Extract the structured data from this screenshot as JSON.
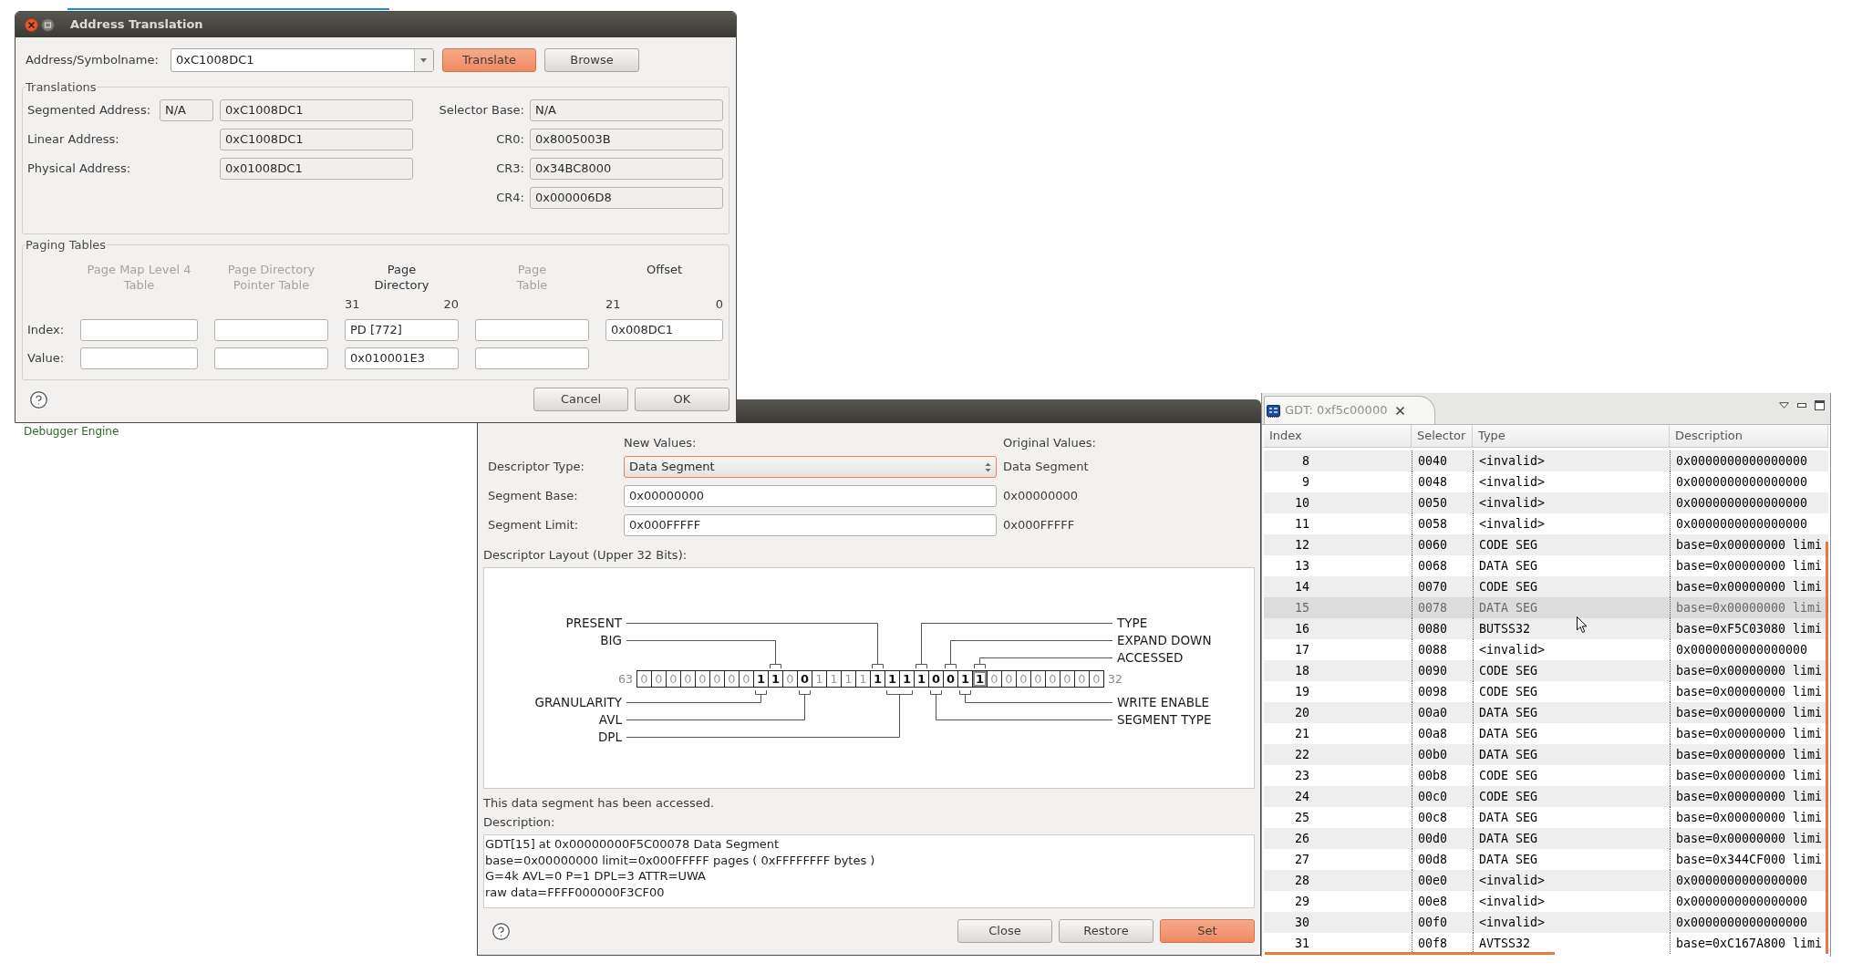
{
  "desktop": {
    "background_text": "Debugger Engine"
  },
  "address_translation": {
    "title": "Address Translation",
    "address": {
      "label": "Address/Symbolname:",
      "value": "0xC1008DC1"
    },
    "actions": [
      {
        "label": "Translate",
        "default": true
      },
      {
        "label": "Browse",
        "default": false
      }
    ],
    "translations": {
      "title": "Translations",
      "left": [
        {
          "label": "Segmented Address:",
          "selector": "N/A",
          "value": "0xC1008DC1"
        },
        {
          "label": "Linear Address:",
          "value": "0xC1008DC1"
        },
        {
          "label": "Physical Address:",
          "value": "0x01008DC1"
        }
      ],
      "right": [
        {
          "label": "Selector Base:",
          "value": "N/A"
        },
        {
          "label": "CR0:",
          "value": "0x8005003B"
        },
        {
          "label": "CR3:",
          "value": "0x34BC8000"
        },
        {
          "label": "CR4:",
          "value": "0x000006D8"
        }
      ]
    },
    "paging": {
      "title": "Paging Tables",
      "columns": [
        {
          "header": [
            "Page Map Level 4",
            "Table"
          ],
          "disabled": true
        },
        {
          "header": [
            "Page Directory",
            "Pointer Table"
          ],
          "disabled": true
        },
        {
          "header": [
            "Page",
            "Directory"
          ],
          "disabled": false,
          "bits": {
            "high": "31",
            "low": "20"
          }
        },
        {
          "header": [
            "Page",
            "Table"
          ],
          "disabled": true
        },
        {
          "header": [
            "Offset"
          ],
          "disabled": false,
          "bits": {
            "high": "21",
            "low": "0"
          }
        }
      ],
      "rows": [
        {
          "label": "Index:",
          "fields": [
            {
              "read_only": false
            },
            {
              "read_only": false
            },
            {
              "text": "PD [772]",
              "read_only": false
            },
            {
              "read_only": false
            },
            {
              "text": "0x008DC1",
              "read_only": false
            }
          ]
        },
        {
          "label": "Value:",
          "fields": [
            {
              "read_only": false
            },
            {
              "read_only": false
            },
            {
              "text": "0x010001E3",
              "read_only": false
            },
            {
              "read_only": false
            }
          ]
        }
      ]
    },
    "buttons": [
      {
        "label": "Cancel",
        "default": false
      },
      {
        "label": "OK",
        "default": false
      }
    ]
  },
  "descriptor_editor": {
    "new_values_heading": "New Values:",
    "original_values_heading": "Original Values:",
    "fields": [
      {
        "kind": "select",
        "label": "Descriptor Type:",
        "value": "Data Segment",
        "original": "Data Segment",
        "focused": true
      },
      {
        "kind": "text",
        "label": "Segment Base:",
        "value": "0x00000000",
        "original": "0x00000000",
        "focused": false
      },
      {
        "kind": "text",
        "label": "Segment Limit:",
        "value": "0x000FFFFF",
        "original": "0x000FFFFF",
        "focused": false
      }
    ],
    "layout": {
      "title": "Descriptor Layout (Upper 32 Bits):",
      "high_bit": "63",
      "low_bit": "32",
      "segments": [
        {
          "bits": [
            "0",
            "0",
            "0",
            "0",
            "0",
            "0",
            "0",
            "0"
          ],
          "emphasized": false,
          "highlighted": false
        },
        {
          "bits": [
            "1"
          ],
          "emphasized": true,
          "highlighted": false,
          "leader": {
            "text": "GRANULARITY",
            "on_left": true,
            "above": false
          }
        },
        {
          "bits": [
            "1"
          ],
          "emphasized": true,
          "highlighted": false,
          "leader": {
            "text": "BIG",
            "on_left": true,
            "above": true
          }
        },
        {
          "bits": [
            "0"
          ],
          "emphasized": false,
          "highlighted": false
        },
        {
          "bits": [
            "0"
          ],
          "emphasized": true,
          "highlighted": false,
          "leader": {
            "text": "AVL",
            "on_left": true,
            "above": false
          }
        },
        {
          "bits": [
            "1",
            "1",
            "1",
            "1"
          ],
          "emphasized": false,
          "highlighted": false
        },
        {
          "bits": [
            "1"
          ],
          "emphasized": true,
          "highlighted": false,
          "leader": {
            "text": "PRESENT",
            "on_left": true,
            "above": true
          }
        },
        {
          "bits": [
            "1",
            "1"
          ],
          "emphasized": true,
          "highlighted": false,
          "leader": {
            "text": "DPL",
            "on_left": true,
            "above": false
          }
        },
        {
          "bits": [
            "1"
          ],
          "emphasized": true,
          "highlighted": false,
          "leader": {
            "text": "TYPE",
            "on_left": false,
            "above": true
          }
        },
        {
          "bits": [
            "0"
          ],
          "emphasized": true,
          "highlighted": false,
          "leader": {
            "text": "SEGMENT TYPE",
            "on_left": false,
            "above": false
          }
        },
        {
          "bits": [
            "0"
          ],
          "emphasized": true,
          "highlighted": false,
          "leader": {
            "text": "EXPAND DOWN",
            "on_left": false,
            "above": true
          }
        },
        {
          "bits": [
            "1"
          ],
          "emphasized": true,
          "highlighted": false,
          "leader": {
            "text": "WRITE ENABLE",
            "on_left": false,
            "above": false
          }
        },
        {
          "bits": [
            "1"
          ],
          "emphasized": true,
          "highlighted": true,
          "leader": {
            "text": "ACCESSED",
            "on_left": false,
            "above": true
          }
        },
        {
          "bits": [
            "0",
            "0",
            "0",
            "0",
            "0",
            "0",
            "0",
            "0"
          ],
          "emphasized": false,
          "highlighted": false
        }
      ]
    },
    "status": "This data segment has been accessed.",
    "description_label": "Description:",
    "description_lines": [
      "GDT[15] at 0x00000000F5C00078 Data Segment",
      "base=0x00000000 limit=0x000FFFFF pages ( 0xFFFFFFFF bytes )",
      "G=4k AVL=0 P=1 DPL=3 ATTR=UWA",
      "raw data=FFFF000000F3CF00"
    ],
    "buttons": [
      {
        "label": "Close",
        "default": false
      },
      {
        "label": "Restore",
        "default": false
      },
      {
        "label": "Set",
        "default": true
      }
    ]
  },
  "gdt_view": {
    "tab": {
      "title": "GDT: 0xf5c00000",
      "active": false
    },
    "columns": [
      "Index",
      "Selector",
      "Type",
      "Description"
    ],
    "rows": [
      {
        "index": "8",
        "selector": "0040",
        "type": "<invalid>",
        "description": "0x0000000000000000",
        "selected": false
      },
      {
        "index": "9",
        "selector": "0048",
        "type": "<invalid>",
        "description": "0x0000000000000000",
        "selected": false
      },
      {
        "index": "10",
        "selector": "0050",
        "type": "<invalid>",
        "description": "0x0000000000000000",
        "selected": false
      },
      {
        "index": "11",
        "selector": "0058",
        "type": "<invalid>",
        "description": "0x0000000000000000",
        "selected": false
      },
      {
        "index": "12",
        "selector": "0060",
        "type": "CODE SEG",
        "description": "base=0x00000000 limi",
        "selected": false
      },
      {
        "index": "13",
        "selector": "0068",
        "type": "DATA SEG",
        "description": "base=0x00000000 limi",
        "selected": false
      },
      {
        "index": "14",
        "selector": "0070",
        "type": "CODE SEG",
        "description": "base=0x00000000 limi",
        "selected": false
      },
      {
        "index": "15",
        "selector": "0078",
        "type": "DATA SEG",
        "description": "base=0x00000000 limi",
        "selected": true
      },
      {
        "index": "16",
        "selector": "0080",
        "type": "BUTSS32",
        "description": "base=0xF5C03080 limi",
        "selected": false
      },
      {
        "index": "17",
        "selector": "0088",
        "type": "<invalid>",
        "description": "0x0000000000000000",
        "selected": false
      },
      {
        "index": "18",
        "selector": "0090",
        "type": "CODE SEG",
        "description": "base=0x00000000 limi",
        "selected": false
      },
      {
        "index": "19",
        "selector": "0098",
        "type": "CODE SEG",
        "description": "base=0x00000000 limi",
        "selected": false
      },
      {
        "index": "20",
        "selector": "00a0",
        "type": "DATA SEG",
        "description": "base=0x00000000 limi",
        "selected": false
      },
      {
        "index": "21",
        "selector": "00a8",
        "type": "DATA SEG",
        "description": "base=0x00000000 limi",
        "selected": false
      },
      {
        "index": "22",
        "selector": "00b0",
        "type": "DATA SEG",
        "description": "base=0x00000000 limi",
        "selected": false
      },
      {
        "index": "23",
        "selector": "00b8",
        "type": "CODE SEG",
        "description": "base=0x00000000 limi",
        "selected": false
      },
      {
        "index": "24",
        "selector": "00c0",
        "type": "CODE SEG",
        "description": "base=0x00000000 limi",
        "selected": false
      },
      {
        "index": "25",
        "selector": "00c8",
        "type": "DATA SEG",
        "description": "base=0x00000000 limi",
        "selected": false
      },
      {
        "index": "26",
        "selector": "00d0",
        "type": "DATA SEG",
        "description": "base=0x00000000 limi",
        "selected": false
      },
      {
        "index": "27",
        "selector": "00d8",
        "type": "DATA SEG",
        "description": "base=0x344CF000 limi",
        "selected": false
      },
      {
        "index": "28",
        "selector": "00e0",
        "type": "<invalid>",
        "description": "0x0000000000000000",
        "selected": false
      },
      {
        "index": "29",
        "selector": "00e8",
        "type": "<invalid>",
        "description": "0x0000000000000000",
        "selected": false
      },
      {
        "index": "30",
        "selector": "00f0",
        "type": "<invalid>",
        "description": "0x0000000000000000",
        "selected": false
      },
      {
        "index": "31",
        "selector": "00f8",
        "type": "AVTSS32",
        "description": "base=0xC167A800 limi",
        "selected": false
      }
    ]
  }
}
